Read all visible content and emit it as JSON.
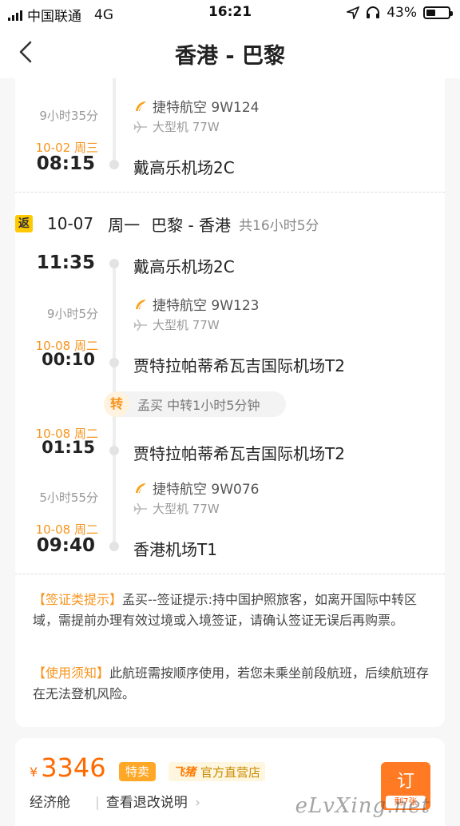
{
  "status_bar": {
    "carrier": "中国联通",
    "network": "4G",
    "time": "16:21",
    "battery_text": "43%",
    "battery_level": 0.43
  },
  "nav": {
    "title": "香港 - 巴黎",
    "back_icon": "chevron-left-icon"
  },
  "outbound_tail": {
    "duration": "9小时35分",
    "airline": "捷特航空 9W124",
    "plane": "大型机 77W",
    "arrive_date": "10-02 周三",
    "arrive_time": "08:15",
    "arrive_airport": "戴高乐机场2C"
  },
  "return_trip": {
    "badge": "返",
    "date": "10-07",
    "weekday": "周一",
    "route": "巴黎 - 香港",
    "total": "共16小时5分",
    "leg1": {
      "depart_time": "11:35",
      "depart_airport": "戴高乐机场2C",
      "duration": "9小时5分",
      "airline": "捷特航空 9W123",
      "plane": "大型机 77W",
      "arrive_date": "10-08 周二",
      "arrive_time": "00:10",
      "arrive_airport": "贾特拉帕蒂希瓦吉国际机场T2"
    },
    "transfer": {
      "tag": "转",
      "text": "孟买 中转1小时5分钟"
    },
    "leg2": {
      "depart_date": "10-08 周二",
      "depart_time": "01:15",
      "depart_airport": "贾特拉帕蒂希瓦吉国际机场T2",
      "duration": "5小时55分",
      "airline": "捷特航空 9W076",
      "plane": "大型机 77W",
      "arrive_date": "10-08 周二",
      "arrive_time": "09:40",
      "arrive_airport": "香港机场T1"
    }
  },
  "notices": {
    "visa_label": "【签证类提示】",
    "visa_text": "孟买--签证提示:持中国护照旅客，如离开国际中转区域，需提前办理有效过境或入境签证，请确认签证无误后再购票。",
    "usage_label": "【使用须知】",
    "usage_text": "此航班需按顺序使用，若您未乘坐前段航班，后续航班存在无法登机风险。"
  },
  "booking": {
    "currency": "¥",
    "price": "3346",
    "special_tag": "特卖",
    "store_logo": "飞猪",
    "store_name": "官方直营店",
    "cabin": "经济舱",
    "refund_link": "查看退改说明",
    "book_label": "订",
    "remaining": "剩7张",
    "watermark": "eLvXing.net"
  },
  "colors": {
    "accent": "#f7941d",
    "price": "#ff6a00",
    "badge": "#ffc900"
  }
}
